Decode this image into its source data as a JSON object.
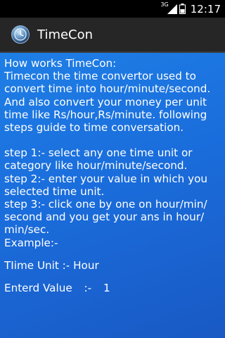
{
  "status_bar": {
    "network": "3G",
    "time": "12:17",
    "icons": [
      "signal-icon",
      "battery-icon"
    ]
  },
  "action_bar": {
    "title": "TimeCon",
    "icon": "timecon-app-icon"
  },
  "content": {
    "heading": "How works TimeCon:",
    "intro": "Timecon the time convertor used to convert time into hour/minute/second. And also convert your money per unit time like Rs/hour,Rs/minute. following steps guide to time conversation.",
    "steps": [
      "step 1:- select any one time unit or category like hour/minute/second.",
      "step 2:- enter your value in which you selected time unit.",
      "step 3:- click one by one on hour/min/ second and you get your ans in hour/ min/sec."
    ],
    "example_label": "Example:-",
    "time_unit_line": "TIime Unit :- Hour",
    "entered_value_label": "Enterd Value",
    "entered_value_sep": ":-",
    "entered_value": "1"
  },
  "colors": {
    "content_background_top": "#1f7fe6",
    "content_background_bottom": "#1959c4",
    "action_bar": "#262626",
    "status_bar": "#000000"
  }
}
